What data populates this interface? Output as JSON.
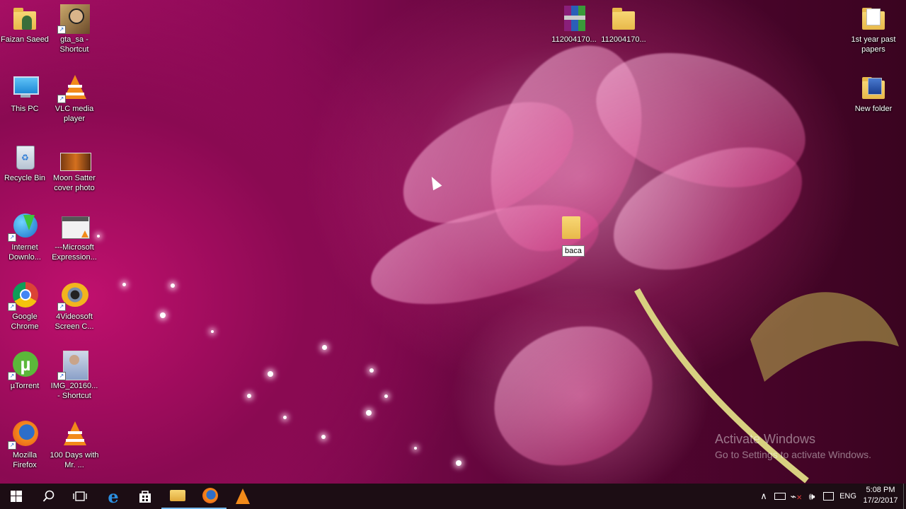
{
  "desktop_icons": {
    "faizan": "Faizan Saeed",
    "gta": "gta_sa - Shortcut",
    "thispc": "This PC",
    "vlc": "VLC media player",
    "recycle": "Recycle Bin",
    "moon": "Moon Satter cover photo",
    "idm": "Internet Downlo...",
    "msexpr": "---Microsoft Expression...",
    "chrome": "Google Chrome",
    "fourvideo": "4Videosoft Screen C...",
    "utorrent": "µTorrent",
    "img": "IMG_20160... - Shortcut",
    "firefox": "Mozilla Firefox",
    "hundred": "100 Days with Mr. ...",
    "rar1": "112004170...",
    "folder2": "112004170...",
    "pastpapers": "1st year past papers",
    "newfolder": "New folder",
    "baca": "baca"
  },
  "watermark": {
    "title": "Activate Windows",
    "subtitle": "Go to Settings to activate Windows."
  },
  "taskbar": {
    "language": "ENG",
    "time": "5:08 PM",
    "date": "17/2/2017"
  },
  "colors": {
    "accent_indicator": "#76b9ed",
    "taskbar_bg": "#1c0d14"
  }
}
